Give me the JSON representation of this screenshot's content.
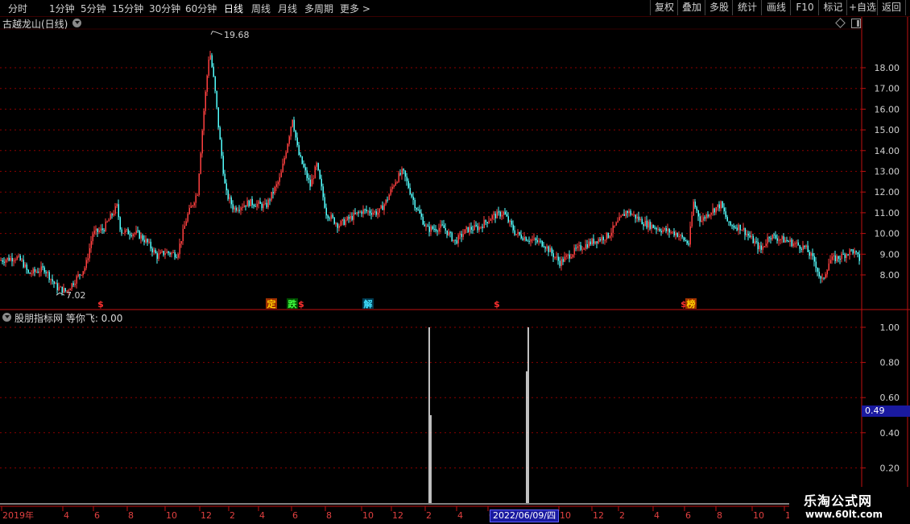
{
  "toolbar": {
    "periods": [
      "分时",
      "1分钟",
      "5分钟",
      "15分钟",
      "30分钟",
      "60分钟",
      "日线",
      "周线",
      "月线",
      "多周期",
      "更多 >"
    ],
    "active_period": "日线",
    "right_buttons": [
      "复权",
      "叠加",
      "多股",
      "统计",
      "画线",
      "F10",
      "标记",
      "+自选",
      "返回"
    ]
  },
  "main_chart": {
    "title": "古越龙山(日线)",
    "high_label": "19.68",
    "low_label": "7.02",
    "y_ticks": [
      "18.00",
      "17.00",
      "16.00",
      "15.00",
      "14.00",
      "13.00",
      "12.00",
      "11.00",
      "10.00",
      "9.00",
      "8.00"
    ],
    "markers": [
      {
        "text": "$",
        "color": "#ff3030"
      },
      {
        "text": "定",
        "color": "#ffd000",
        "bg": "#a03000"
      },
      {
        "text": "跌",
        "color": "#40ff40",
        "bg": "#005000"
      },
      {
        "text": "$",
        "color": "#ff3030"
      },
      {
        "text": "解",
        "color": "#40e0ff",
        "bg": "#003a50"
      },
      {
        "text": "$",
        "color": "#ff3030"
      },
      {
        "text": "$",
        "color": "#ff3030"
      },
      {
        "text": "榜",
        "color": "#ffd000",
        "bg": "#a03000"
      }
    ]
  },
  "indicator": {
    "title": "股朋指标网 等你飞: 0.00",
    "y_ticks": [
      "1.00",
      "0.80",
      "0.60",
      "0.40",
      "0.20"
    ],
    "current_value": "0.49"
  },
  "x_axis": {
    "labels": [
      "2019年",
      "4",
      "6",
      "8",
      "10",
      "12",
      "2",
      "4",
      "6",
      "8",
      "10",
      "12",
      "2",
      "4",
      "6",
      "10",
      "12",
      "2",
      "4",
      "6",
      "8",
      "10",
      "1"
    ],
    "cursor_date": "2022/06/09/四"
  },
  "watermark": {
    "title": "乐淘公式网",
    "url": "www.60lt.com"
  },
  "colors": {
    "up": "#ff4040",
    "down": "#54ffff",
    "grid": "#8b0000",
    "axis": "#c01010",
    "indicator_line": "#ffffff"
  }
}
